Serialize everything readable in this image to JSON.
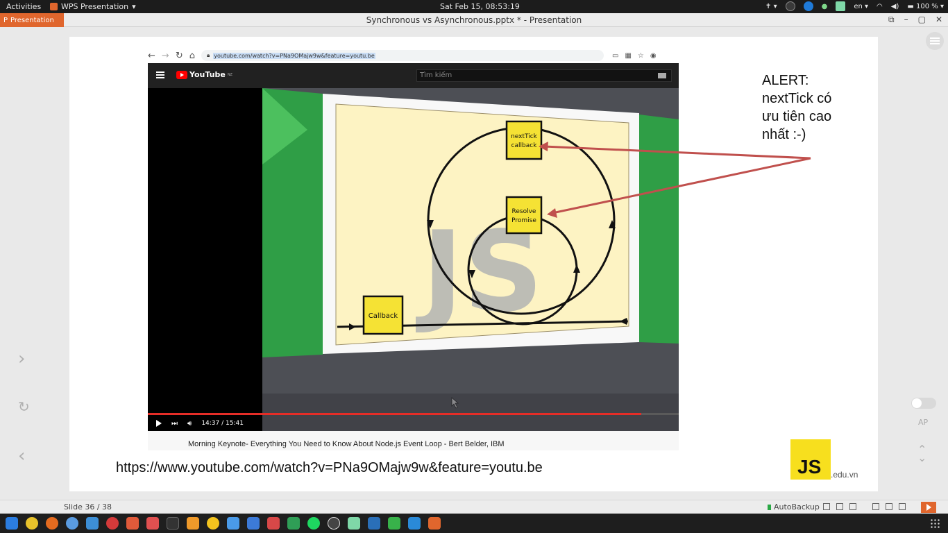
{
  "topbar": {
    "activities": "Activities",
    "app_name": "WPS Presentation",
    "clock": "Sat Feb 15, 08:53:19",
    "lang": "en",
    "battery": "100 %"
  },
  "titlebar": {
    "app_tab": "Presentation",
    "document_title": "Synchronous vs Asynchronous.pptx * - Presentation"
  },
  "slide": {
    "browser_url": "youtube.com/watch?v=PNa9OMajw9w&feature=youtu.be",
    "youtube": {
      "logo_text": "YouTube",
      "region": "NZ",
      "search_placeholder": "Tìm kiếm",
      "time": "14:37 / 15:41",
      "progress_fraction": 0.93
    },
    "diagram": {
      "box_top": [
        "nextTick",
        "callback"
      ],
      "box_mid": [
        "Resolve",
        "Promise"
      ],
      "box_left": "Callback",
      "watermark": "JS"
    },
    "video_caption": "Morning Keynote- Everything You Need to Know About Node.js Event Loop - Bert Belder, IBM",
    "link": "https://www.youtube.com/watch?v=PNa9OMajw9w&feature=youtu.be",
    "alert_lines": [
      "ALERT:",
      "nextTick có",
      "ưu tiên cao",
      "nhất :-)"
    ],
    "logo_js": "JS",
    "logo_domain": ".edu.vn"
  },
  "side": {
    "toggle_label": "AP"
  },
  "statusbar": {
    "slide_number": "Slide 36 / 38",
    "autobackup": "AutoBackup"
  },
  "colors": {
    "wps_orange": "#e0662d",
    "arrow_red": "#c0504d",
    "js_yellow": "#f7df1e",
    "youtube_red": "#ff0000"
  }
}
